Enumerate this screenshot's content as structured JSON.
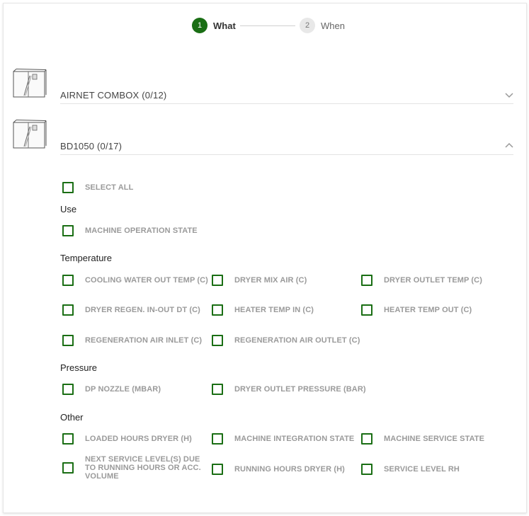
{
  "stepper": {
    "steps": [
      {
        "number": "1",
        "label": "What"
      },
      {
        "number": "2",
        "label": "When"
      }
    ]
  },
  "machines": [
    {
      "title": "AIRNET COMBOX (0/12)",
      "expanded": false
    },
    {
      "title": "BD1050 (0/17)",
      "expanded": true
    }
  ],
  "bd1050": {
    "select_all": "SELECT ALL",
    "groups": [
      {
        "title": "Use",
        "items": [
          "MACHINE OPERATION STATE"
        ]
      },
      {
        "title": "Temperature",
        "items": [
          "COOLING WATER OUT TEMP (C)",
          "DRYER MIX AIR (C)",
          "DRYER OUTLET TEMP (C)",
          "DRYER REGEN. IN-OUT DT (C)",
          "HEATER TEMP IN (C)",
          "HEATER TEMP OUT (C)",
          "REGENERATION AIR INLET (C)",
          "REGENERATION AIR OUTLET (C)"
        ]
      },
      {
        "title": "Pressure",
        "items": [
          "DP NOZZLE (MBAR)",
          "DRYER OUTLET PRESSURE (BAR)"
        ]
      },
      {
        "title": "Other",
        "items": [
          "LOADED HOURS DRYER (H)",
          "MACHINE INTEGRATION STATE",
          "MACHINE SERVICE STATE",
          "NEXT SERVICE LEVEL(S) DUE TO RUNNING HOURS OR ACC. VOLUME",
          "RUNNING HOURS DRYER (H)",
          "SERVICE LEVEL RH"
        ]
      }
    ]
  },
  "colors": {
    "accent": "#1a6e14",
    "muted_label": "#9a9a9a"
  }
}
